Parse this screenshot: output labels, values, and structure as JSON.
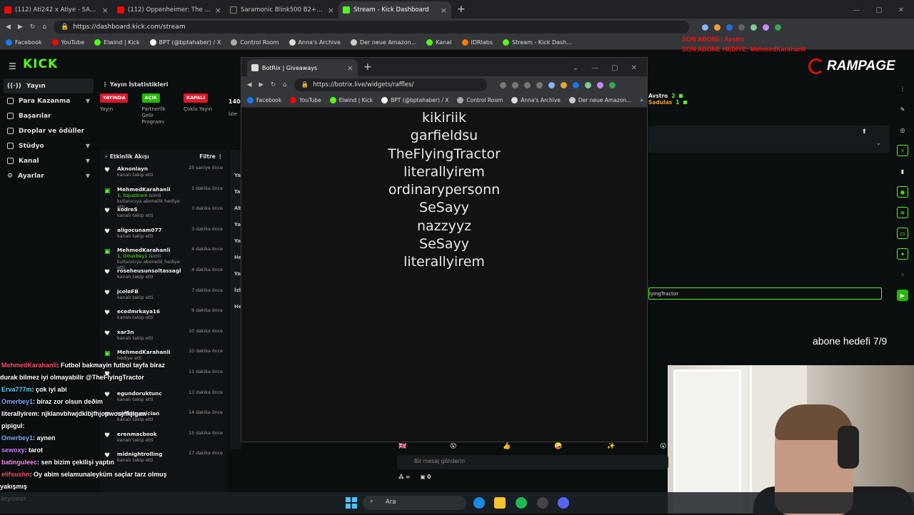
{
  "browser": {
    "tabs": [
      {
        "title": "(112) Ati242 x Atiye - SALLA X",
        "icon": "youtube-icon"
      },
      {
        "title": "(112) Oppenheimer: The Ult",
        "icon": "youtube-icon"
      },
      {
        "title": "Saramonic Blink500 B2+ 2 Kişili",
        "icon": "saramonic-icon"
      },
      {
        "title": "Stream - Kick Dashboard",
        "icon": "kick-icon"
      }
    ],
    "url": "https://dashboard.kick.com/stream",
    "bookmarks": [
      "Facebook",
      "YouTube",
      "Elwind | Kick",
      "BPT (@bptahaber) / X",
      "Control Room",
      "Anna's Archive",
      "Der neue Amazon...",
      "Kanal",
      "IDRlabs",
      "Stream - Kick Dash..."
    ]
  },
  "overlay": {
    "last_sub_line1": "SON ABONE: Avstro",
    "last_sub_line2": "SON ABONE HEDİYE: MehmedKarahanli",
    "brand": "RAMPAGE",
    "sub_goal": "abone hedefi 7/9"
  },
  "kick": {
    "logo": "KICK",
    "nav": [
      {
        "label": "Yayın",
        "active": true
      },
      {
        "label": "Para Kazanma",
        "chevron": true
      },
      {
        "label": "Başarılar"
      },
      {
        "label": "Droplar ve ödüller"
      },
      {
        "label": "Stüdyo",
        "chevron": true
      },
      {
        "label": "Kanal",
        "chevron": true
      },
      {
        "label": "Ayarlar",
        "chevron": true
      }
    ],
    "stats": {
      "title": "Yayın İstatistikleri",
      "items": [
        {
          "badge": "YAYINDA",
          "label": "Yayın",
          "color": "#d9192b"
        },
        {
          "badge": "AÇIK",
          "label": "Partnerlik Gelir Programı",
          "color": "#26b800"
        },
        {
          "badge": "KAPALI",
          "label": "Çoklu Yayın",
          "color": "#d9192b"
        }
      ],
      "viewers": "140",
      "viewers_label": "İzle"
    },
    "activity": {
      "title": "Etkinlik Akışı",
      "filter": "Filtre",
      "items": [
        {
          "name": "Aknonlayn",
          "text": "kanalı takip etti",
          "time": "25 saniye önce",
          "type": "follow"
        },
        {
          "name": "MehmedKarahanli",
          "gift": "1, itsjustirem",
          "text": "isimli kullanıcıya abonelik hediye etti.",
          "time": "1 dakika önce",
          "type": "sub"
        },
        {
          "name": "xodreS",
          "text": "kanalı takip etti",
          "time": "3 dakika önce",
          "type": "follow"
        },
        {
          "name": "aligocunam077",
          "text": "kanalı takip etti",
          "time": "3 dakika önce",
          "type": "follow"
        },
        {
          "name": "MehmedKarahanli",
          "gift": "1, Omerbey1",
          "text": "isimli kullanıcıya abonelik hediye etti.",
          "time": "4 dakika önce",
          "type": "sub"
        },
        {
          "name": "roseheusunsoltassagl",
          "text": "kanalı takip etti",
          "time": "4 dakika önce",
          "type": "follow"
        },
        {
          "name": "jcoleFB",
          "text": "kanalı takip etti",
          "time": "7 dakika önce",
          "type": "follow"
        },
        {
          "name": "ecedmrkaya16",
          "text": "kanalı takip etti",
          "time": "9 dakika önce",
          "type": "follow"
        },
        {
          "name": "xar3n",
          "text": "kanalı takip etti",
          "time": "10 dakika önce",
          "type": "follow"
        },
        {
          "name": "MehmedKarahanli",
          "text": "hediye etti.",
          "time": "10 dakika önce",
          "type": "sub"
        },
        {
          "name": "",
          "text": "",
          "time": "11 dakika önce",
          "type": "follow"
        },
        {
          "name": "egundoruktunc",
          "text": "kanalı takip etti",
          "time": "13 dakika önce",
          "type": "follow"
        },
        {
          "name": "sufflemusician",
          "text": "kanalı takip etti",
          "time": "14 dakika önce",
          "type": "follow"
        },
        {
          "name": "erenmacbook",
          "text": "kanalı takip etti",
          "time": "15 dakika önce",
          "type": "follow"
        },
        {
          "name": "midnightrolling",
          "text": "kanalı takip etti",
          "time": "17 dakika önce",
          "type": "follow"
        }
      ]
    },
    "mid_labels": [
      "Ya",
      "Ta",
      "Ab",
      "Ya",
      "Ya",
      "He",
      "Ya",
      "İzl",
      "He"
    ],
    "donors": [
      {
        "name": "Avstro",
        "count": "2"
      },
      {
        "name": "Sadulas",
        "count": "1"
      }
    ],
    "preview_text": "lyingTractor",
    "chat_placeholder": "Bir mesaj gönderin",
    "chat_footer": {
      "points": "0",
      "infinity": "∞"
    }
  },
  "popup": {
    "tab": "BotRix | Giveaways",
    "url": "https://botrix.live/widgets/raffles/",
    "bookmarks": [
      "Facebook",
      "YouTube",
      "Elwind | Kick",
      "BPT (@bptahaber) / X",
      "Control Room",
      "Anna's Archive",
      "Der neue Amazon..."
    ],
    "raffle_entries": [
      "kikiriik",
      "garfieldsu",
      "TheFlyingTractor",
      "literallyirem",
      "ordinarypersonn",
      "SeSayy",
      "nazzyyz",
      "SeSayy",
      "literallyirem"
    ]
  },
  "chat_overlay": [
    {
      "user": "MehmedKarahanli",
      "color": "#ff4d6a",
      "msg": ": Futbol bakmayin futbol tayfa biraz"
    },
    {
      "user": "",
      "color": "#ffffff",
      "msg": "durak bilmez iyi olmayabilir @TheFlyingTractor"
    },
    {
      "user": "Erva777m",
      "color": "#5bd1ff",
      "msg": ": çok iyi abi"
    },
    {
      "user": "Omerbey1",
      "color": "#7fa8ff",
      "msg": ": biraz zor olsun deðim"
    },
    {
      "user": "literallyirem",
      "color": "#ffffff",
      "msg": ": njklanvbhwjdklbjfhjopwosjnkjlgaw"
    },
    {
      "user": "pipigul",
      "color": "#ffffff",
      "msg": ":"
    },
    {
      "user": "Omerbey1",
      "color": "#7fa8ff",
      "msg": ": aynen"
    },
    {
      "user": "sewoxy",
      "color": "#d07cff",
      "msg": ": tarot"
    },
    {
      "user": "batinguleec",
      "color": "#ff8cf0",
      "msg": ": sen bizim çekilişi yaptın"
    },
    {
      "user": "elifsushn",
      "color": "#ff4d6a",
      "msg": ": Oy abim selamunaleyküm saçlar tarz olmuş"
    },
    {
      "user": "",
      "color": "#ffffff",
      "msg": "yakışmış"
    },
    {
      "user": "kryowei",
      "color": "#ffffff",
      "msg": ":"
    }
  ],
  "taskbar": {
    "search": "Ara"
  }
}
